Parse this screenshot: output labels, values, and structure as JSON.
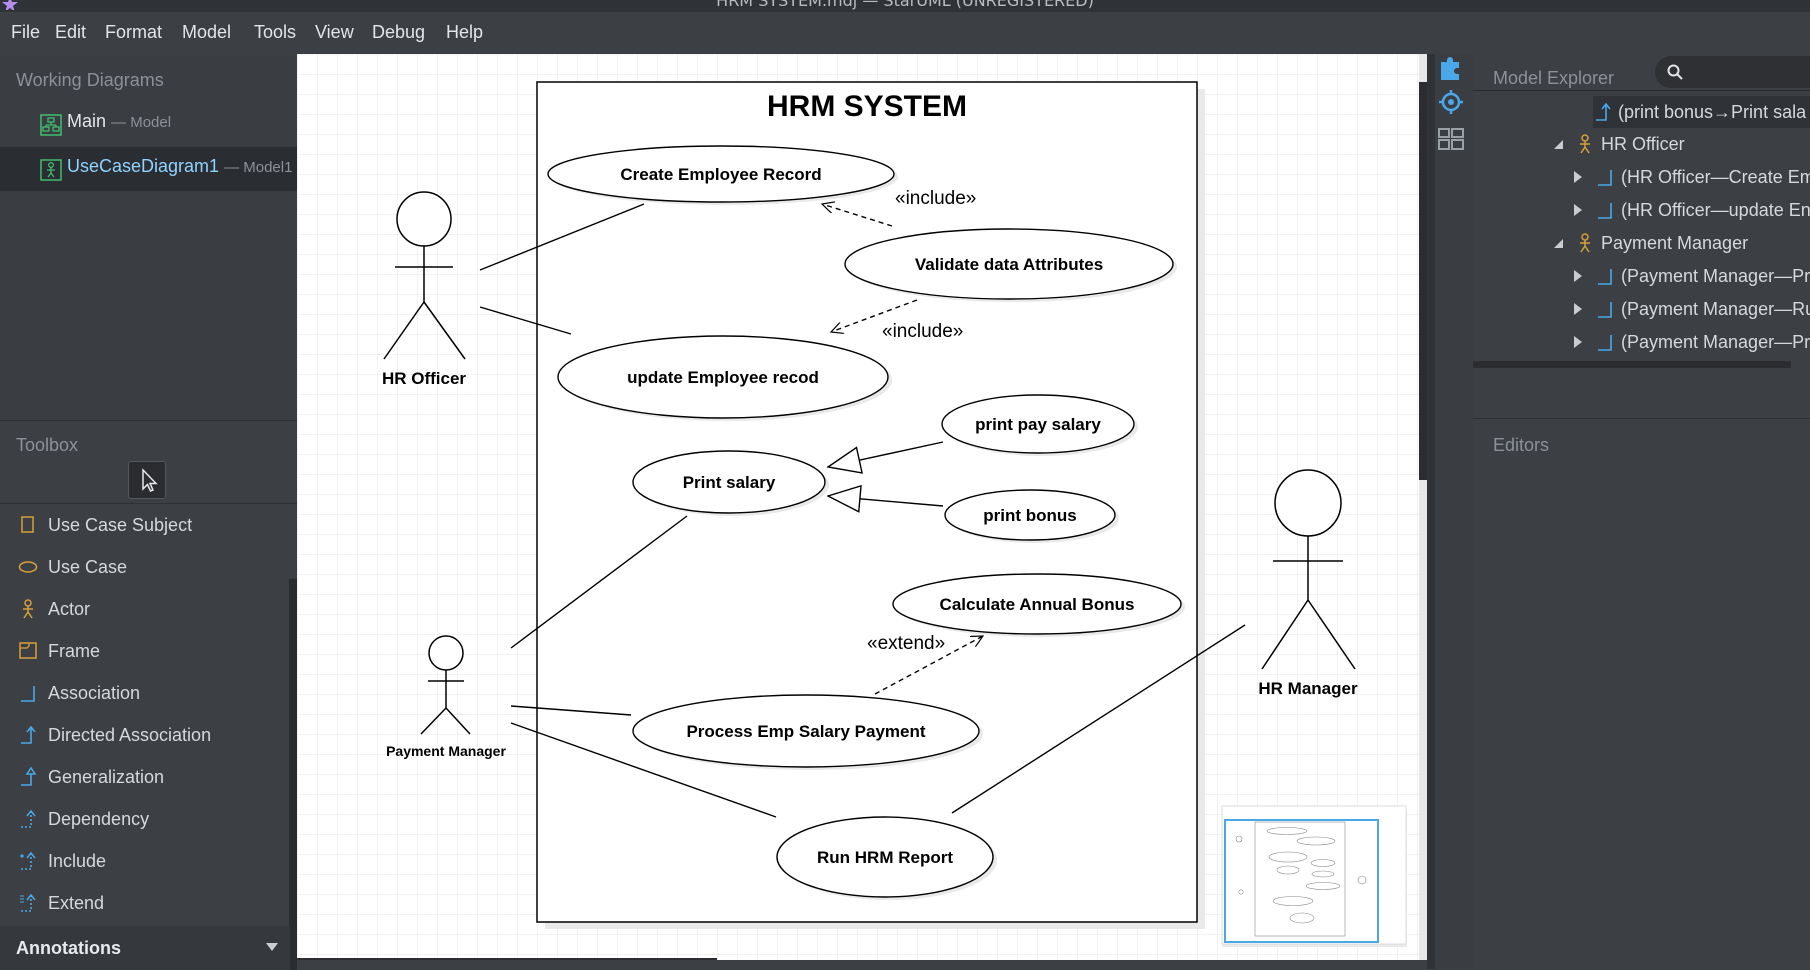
{
  "window": {
    "title": "HRM SYSTEM.mdj — StarUML (UNREGISTERED)"
  },
  "menu": [
    "File",
    "Edit",
    "Format",
    "Model",
    "Tools",
    "View",
    "Debug",
    "Help"
  ],
  "working_diagrams": {
    "title": "Working Diagrams",
    "items": [
      {
        "label": "Main",
        "sub": "— Model"
      },
      {
        "label": "UseCaseDiagram1",
        "sub": "— Model1"
      }
    ]
  },
  "toolbox": {
    "title": "Toolbox",
    "tools": [
      "Use Case Subject",
      "Use Case",
      "Actor",
      "Frame",
      "Association",
      "Directed Association",
      "Generalization",
      "Dependency",
      "Include",
      "Extend"
    ],
    "annotations_label": "Annotations"
  },
  "explorer": {
    "title": "Model Explorer",
    "search_placeholder": "",
    "rows": [
      "(print bonus→Print sala",
      "HR Officer",
      "(HR Officer—Create Em",
      "(HR Officer—update En",
      "Payment Manager",
      "(Payment Manager—Pr",
      "(Payment Manager—Ru",
      "(Payment Manager—Pr"
    ]
  },
  "editors": {
    "title": "Editors"
  },
  "diagram": {
    "subject": "HRM SYSTEM",
    "actors": {
      "hr_officer": "HR Officer",
      "payment_manager": "Payment Manager",
      "hr_manager": "HR Manager"
    },
    "use_cases": {
      "create": "Create Employee Record",
      "validate": "Validate data Attributes",
      "update": "update Employee recod",
      "print_pay": "print pay salary",
      "print_salary": "Print salary",
      "print_bonus": "print bonus",
      "annual_bonus": "Calculate Annual Bonus",
      "process": "Process Emp Salary Payment",
      "report": "Run HRM Report"
    },
    "stereotypes": {
      "include1": "«include»",
      "include2": "«include»",
      "extend": "«extend»"
    }
  },
  "colors": {
    "accent": "#4aa8e8",
    "actor_icon": "#d7a03a",
    "selected_text": "#8fd3ff",
    "diagram_icon": "#3fbf6e"
  }
}
